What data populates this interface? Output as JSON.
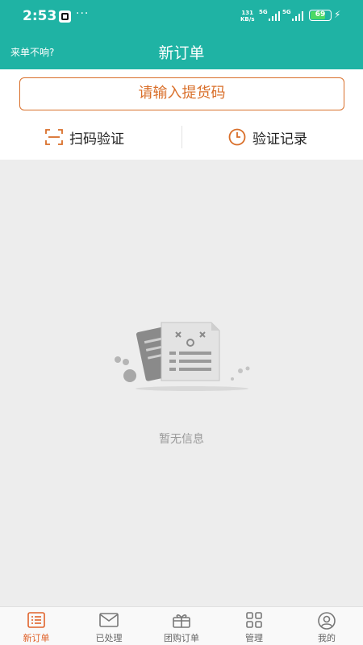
{
  "status_bar": {
    "time": "2:53",
    "dots": "···",
    "speed_value": "131",
    "speed_unit": "KB/s",
    "net1": "5G",
    "net2": "5G",
    "battery": "69"
  },
  "header": {
    "left_link": "来单不响?",
    "title": "新订单"
  },
  "pickup": {
    "button_label": "请输入提货码"
  },
  "actions": {
    "scan_label": "扫码验证",
    "record_label": "验证记录"
  },
  "empty_state": {
    "text": "暂无信息"
  },
  "tabs": [
    {
      "label": "新订单",
      "icon": "order-list-icon",
      "active": true
    },
    {
      "label": "已处理",
      "icon": "mail-icon",
      "active": false
    },
    {
      "label": "团购订单",
      "icon": "gift-icon",
      "active": false
    },
    {
      "label": "管理",
      "icon": "grid-icon",
      "active": false
    },
    {
      "label": "我的",
      "icon": "user-icon",
      "active": false
    }
  ],
  "colors": {
    "brand": "#1fb3a4",
    "accent": "#d96f2a",
    "active_tab": "#e0632b"
  }
}
